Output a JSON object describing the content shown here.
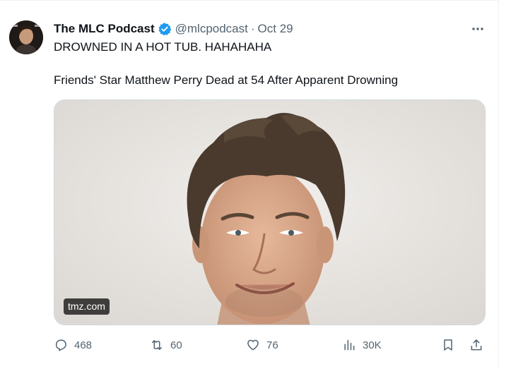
{
  "author": {
    "display_name": "The MLC Podcast",
    "handle": "@mlcpodcast",
    "separator": "·",
    "date": "Oct 29",
    "verified_color": "#1d9bf0"
  },
  "tweet": {
    "text_line1": "DROWNED IN A HOT TUB. HAHAHAHA",
    "text_line2": "Friends' Star Matthew Perry Dead at 54 After Apparent Drowning"
  },
  "media": {
    "source_label": "tmz.com"
  },
  "actions": {
    "reply_count": "468",
    "retweet_count": "60",
    "like_count": "76",
    "view_count": "30K"
  },
  "icons": {
    "more": "more-horizontal-icon",
    "reply": "reply-icon",
    "retweet": "retweet-icon",
    "like": "heart-icon",
    "views": "analytics-icon",
    "bookmark": "bookmark-icon",
    "share": "share-icon"
  },
  "colors": {
    "text": "#0f1419",
    "secondary": "#536471",
    "accent": "#1d9bf0"
  }
}
